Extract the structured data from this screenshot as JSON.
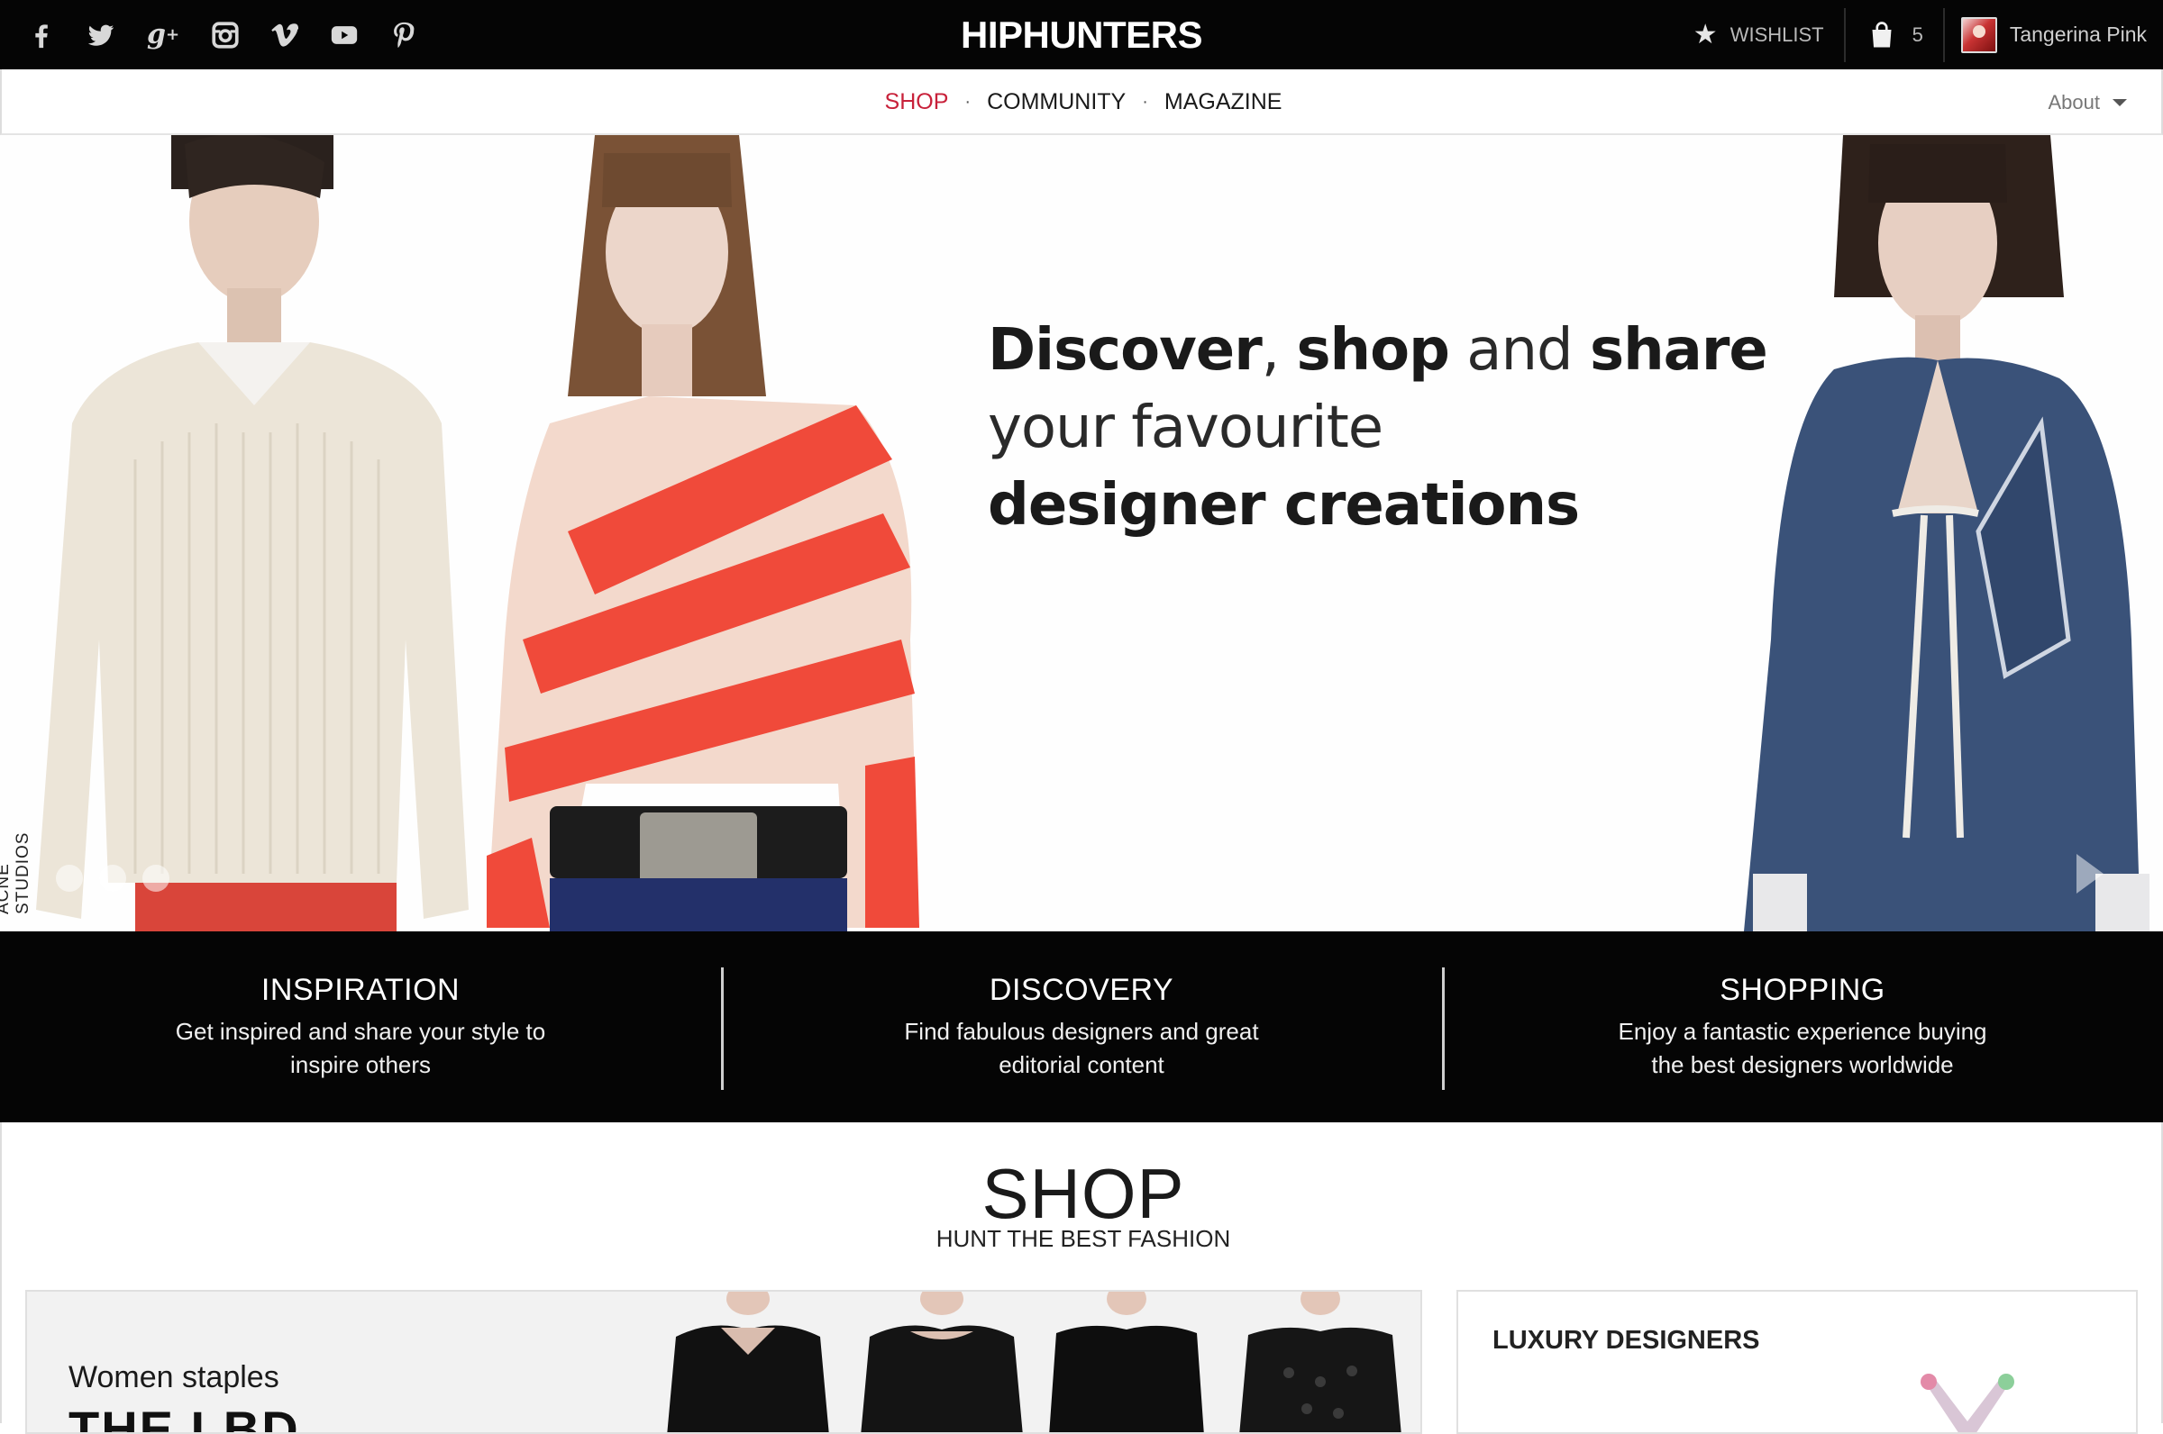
{
  "topbar": {
    "social": [
      "facebook-icon",
      "twitter-icon",
      "google-plus-icon",
      "instagram-icon",
      "vimeo-icon",
      "youtube-icon",
      "pinterest-icon"
    ],
    "brand": "HIPHUNTERS",
    "wishlist_label": "WISHLIST",
    "bag_count": "5",
    "user_name": "Tangerina Pink"
  },
  "nav": {
    "items": [
      {
        "label": "SHOP",
        "active": true
      },
      {
        "label": "COMMUNITY",
        "active": false
      },
      {
        "label": "MAGAZINE",
        "active": false
      }
    ],
    "separator": "·",
    "about_label": "About"
  },
  "hero": {
    "line1_bold1": "Discover",
    "line1_sep": ", ",
    "line1_bold2": "shop",
    "line1_light": " and ",
    "line1_bold3": "share",
    "line2": "your favourite",
    "line3": "designer creations",
    "credit": "ACNE STUDIOS",
    "slide_count": 3,
    "active_slide": 1
  },
  "features": [
    {
      "title": "INSPIRATION",
      "text": "Get inspired and share your style to inspire others"
    },
    {
      "title": "DISCOVERY",
      "text": "Find fabulous designers and great editorial content"
    },
    {
      "title": "SHOPPING",
      "text": "Enjoy a fantastic experience buying the best designers worldwide"
    }
  ],
  "shop": {
    "title": "SHOP",
    "subtitle": "HUNT THE BEST FASHION",
    "card_left": {
      "eyebrow": "Women staples",
      "title": "THE LBD"
    },
    "card_right": {
      "title": "LUXURY DESIGNERS"
    }
  },
  "colors": {
    "topbar_bg": "#050505",
    "accent": "#c8213a",
    "features_bg": "#050505"
  }
}
